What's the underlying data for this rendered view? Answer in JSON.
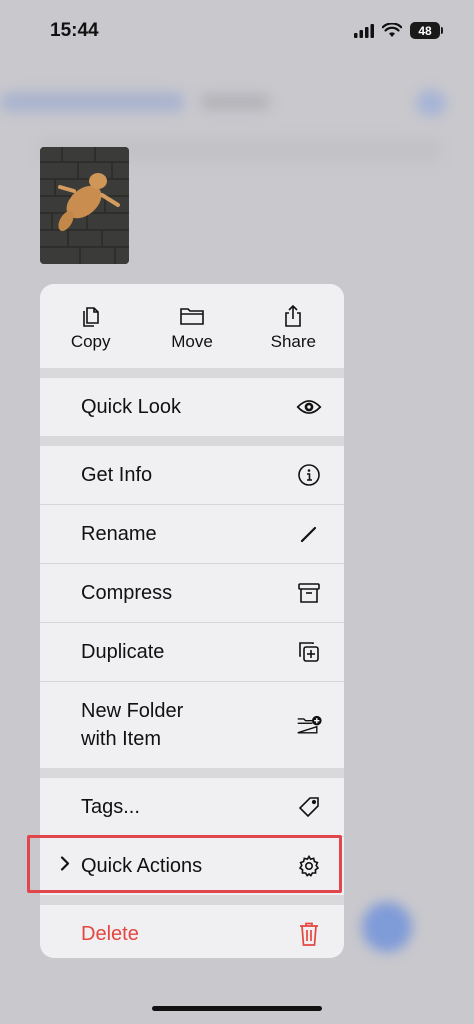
{
  "status": {
    "time": "15:44",
    "battery": "48"
  },
  "top_actions": [
    {
      "label": "Copy",
      "icon": "copy-icon"
    },
    {
      "label": "Move",
      "icon": "folder-icon"
    },
    {
      "label": "Share",
      "icon": "share-icon"
    }
  ],
  "menu": {
    "quick_look": {
      "label": "Quick Look",
      "icon": "eye-icon"
    },
    "get_info": {
      "label": "Get Info",
      "icon": "info-icon"
    },
    "rename": {
      "label": "Rename",
      "icon": "pencil-icon"
    },
    "compress": {
      "label": "Compress",
      "icon": "archive-box-icon"
    },
    "duplicate": {
      "label": "Duplicate",
      "icon": "duplicate-icon"
    },
    "new_folder": {
      "label": "New Folder\nwith Item",
      "icon": "folder-add-icon"
    },
    "tags": {
      "label": "Tags...",
      "icon": "tag-icon"
    },
    "quick_actions": {
      "label": "Quick Actions",
      "icon": "gear-icon"
    },
    "delete": {
      "label": "Delete",
      "icon": "trash-icon"
    }
  },
  "colors": {
    "delete": "#e5463f",
    "highlight": "#e0474c",
    "menu_bg": "#f0f0f2"
  }
}
